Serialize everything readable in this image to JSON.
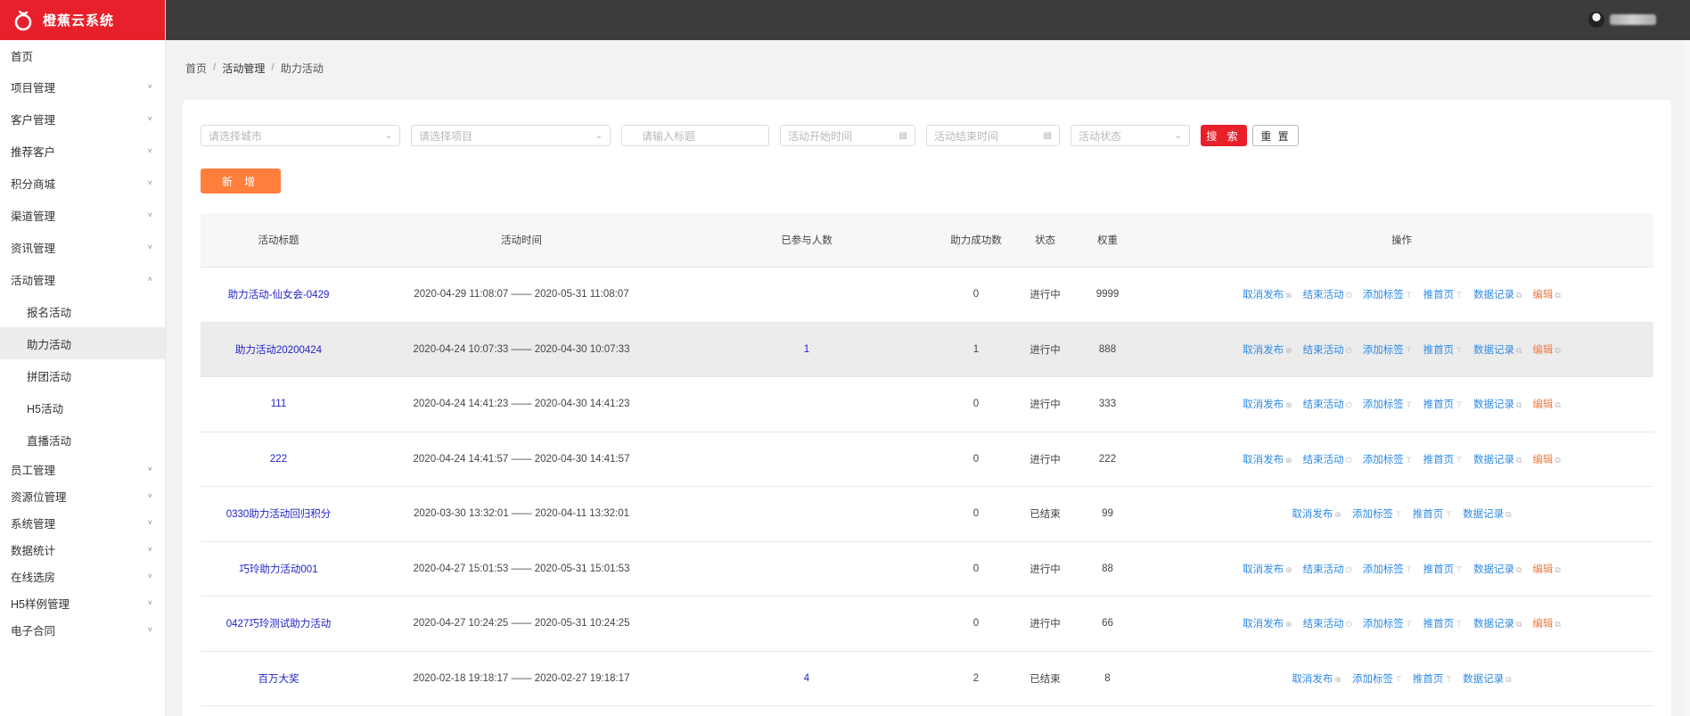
{
  "app": {
    "title": "橙蕉云系统"
  },
  "colors": {
    "brand": "#e8202b",
    "link": "#2e8ae6",
    "edit": "#f07b3f",
    "add_button": "#ff7e3c"
  },
  "sidebar": {
    "top_items": [
      {
        "label": "首页",
        "expandable": false
      },
      {
        "label": "项目管理",
        "expandable": true
      },
      {
        "label": "客户管理",
        "expandable": true
      },
      {
        "label": "推荐客户",
        "expandable": true
      },
      {
        "label": "积分商城",
        "expandable": true
      },
      {
        "label": "渠道管理",
        "expandable": true
      },
      {
        "label": "资讯管理",
        "expandable": true
      }
    ],
    "active_group": {
      "label": "活动管理",
      "expanded": true,
      "children": [
        "报名活动",
        "助力活动",
        "拼团活动",
        "H5活动",
        "直播活动"
      ],
      "active_child": "助力活动"
    },
    "bottom_items": [
      {
        "label": "员工管理"
      },
      {
        "label": "资源位管理"
      },
      {
        "label": "系统管理"
      },
      {
        "label": "数据统计"
      },
      {
        "label": "在线选房"
      },
      {
        "label": "H5样例管理"
      },
      {
        "label": "电子合同"
      }
    ]
  },
  "breadcrumb": {
    "home": "首页",
    "section": "活动管理",
    "page": "助力活动",
    "separator": "/"
  },
  "filters": {
    "city_placeholder": "请选择城市",
    "project_placeholder": "请选择项目",
    "title_placeholder": "请输入标题",
    "start_placeholder": "活动开始时间",
    "end_placeholder": "活动结束时间",
    "status_placeholder": "活动状态",
    "search_label": "搜 索",
    "reset_label": "重 置"
  },
  "toolbar": {
    "add_label": "新 增"
  },
  "table": {
    "headers": {
      "title": "活动标题",
      "time": "活动时间",
      "joined": "已参与人数",
      "success": "助力成功数",
      "state": "状态",
      "weight": "权重",
      "ops": "操作"
    },
    "op_labels": {
      "unpublish": "取消发布",
      "end": "结束活动",
      "tag": "添加标签",
      "home": "推首页",
      "records": "数据记录",
      "edit": "编辑"
    },
    "rows": [
      {
        "title": "助力活动-仙女会-0429",
        "time": "2020-04-29 11:08:07 —— 2020-05-31 11:08:07",
        "joined": "",
        "success": "0",
        "state": "进行中",
        "weight": "9999",
        "ongoing": true
      },
      {
        "title": "助力活动20200424",
        "time": "2020-04-24 10:07:33 —— 2020-04-30 10:07:33",
        "joined": "1",
        "success": "1",
        "state": "进行中",
        "weight": "888",
        "ongoing": true
      },
      {
        "title": "111",
        "time": "2020-04-24 14:41:23 —— 2020-04-30 14:41:23",
        "joined": "",
        "success": "0",
        "state": "进行中",
        "weight": "333",
        "ongoing": true
      },
      {
        "title": "222",
        "time": "2020-04-24 14:41:57 —— 2020-04-30 14:41:57",
        "joined": "",
        "success": "0",
        "state": "进行中",
        "weight": "222",
        "ongoing": true
      },
      {
        "title": "0330助力活动回归积分",
        "time": "2020-03-30 13:32:01 —— 2020-04-11 13:32:01",
        "joined": "",
        "success": "0",
        "state": "已结束",
        "weight": "99",
        "ongoing": false
      },
      {
        "title": "巧玲助力活动001",
        "time": "2020-04-27 15:01:53 —— 2020-05-31 15:01:53",
        "joined": "",
        "success": "0",
        "state": "进行中",
        "weight": "88",
        "ongoing": true
      },
      {
        "title": "0427巧玲测试助力活动",
        "time": "2020-04-27 10:24:25 —— 2020-05-31 10:24:25",
        "joined": "",
        "success": "0",
        "state": "进行中",
        "weight": "66",
        "ongoing": true
      },
      {
        "title": "百万大奖",
        "time": "2020-02-18 19:18:17 —— 2020-02-27 19:18:17",
        "joined": "4",
        "success": "2",
        "state": "已结束",
        "weight": "8",
        "ongoing": false
      }
    ]
  }
}
